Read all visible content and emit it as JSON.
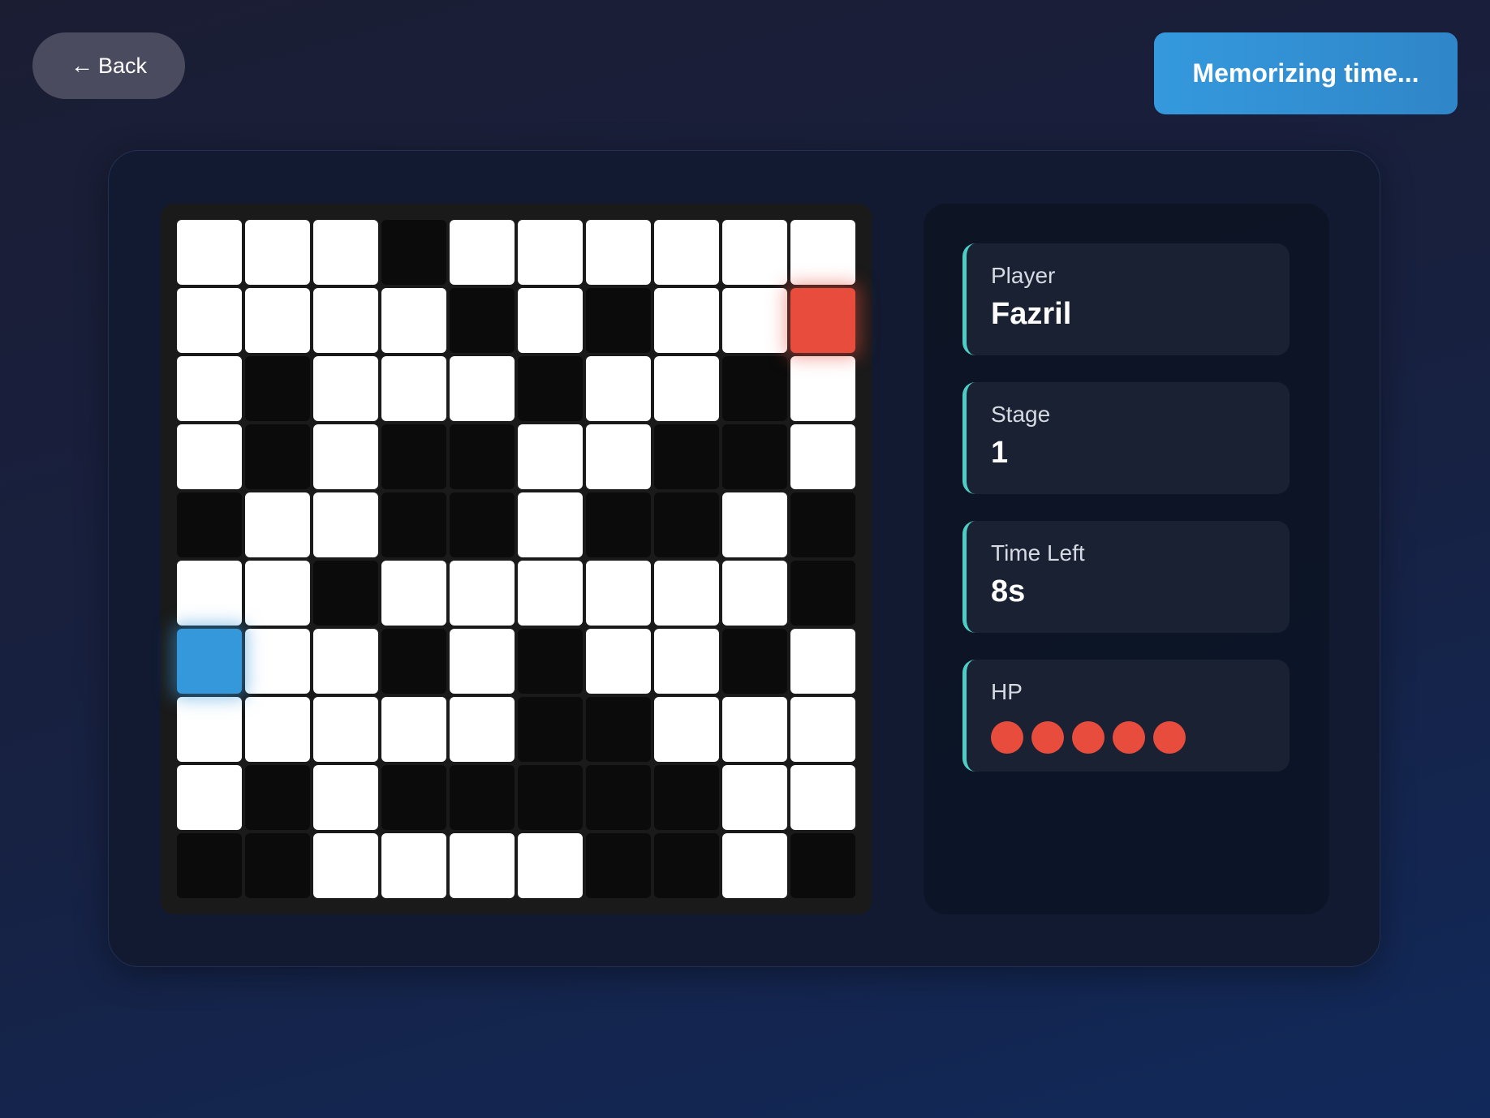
{
  "header": {
    "back_icon": "←",
    "back_label": "Back",
    "status_label": "Memorizing time..."
  },
  "board": {
    "rows": 10,
    "cols": 10,
    "cells": [
      [
        "white",
        "white",
        "white",
        "black",
        "white",
        "white",
        "white",
        "white",
        "white",
        "white"
      ],
      [
        "white",
        "white",
        "white",
        "white",
        "black",
        "white",
        "black",
        "white",
        "white",
        "goal"
      ],
      [
        "white",
        "black",
        "white",
        "white",
        "white",
        "black",
        "white",
        "white",
        "black",
        "white"
      ],
      [
        "white",
        "black",
        "white",
        "black",
        "black",
        "white",
        "white",
        "black",
        "black",
        "white"
      ],
      [
        "black",
        "white",
        "white",
        "black",
        "black",
        "white",
        "black",
        "black",
        "white",
        "black"
      ],
      [
        "white",
        "white",
        "black",
        "white",
        "white",
        "white",
        "white",
        "white",
        "white",
        "black"
      ],
      [
        "start",
        "white",
        "white",
        "black",
        "white",
        "black",
        "white",
        "white",
        "black",
        "white"
      ],
      [
        "white",
        "white",
        "white",
        "white",
        "white",
        "black",
        "black",
        "white",
        "white",
        "white"
      ],
      [
        "white",
        "black",
        "white",
        "black",
        "black",
        "black",
        "black",
        "black",
        "white",
        "white"
      ],
      [
        "black",
        "black",
        "white",
        "white",
        "white",
        "white",
        "black",
        "black",
        "white",
        "black"
      ]
    ],
    "colors": {
      "path": "#ffffff",
      "wall": "#0b0b0b",
      "start": "#3498db",
      "goal": "#e74c3c"
    }
  },
  "stats": {
    "player_label": "Player",
    "player_value": "Fazril",
    "stage_label": "Stage",
    "stage_value": "1",
    "time_label": "Time Left",
    "time_value": "8s",
    "hp_label": "HP",
    "hp_count": 5,
    "hp_color": "#e74c3c",
    "accent_color": "#4ecdc4"
  }
}
